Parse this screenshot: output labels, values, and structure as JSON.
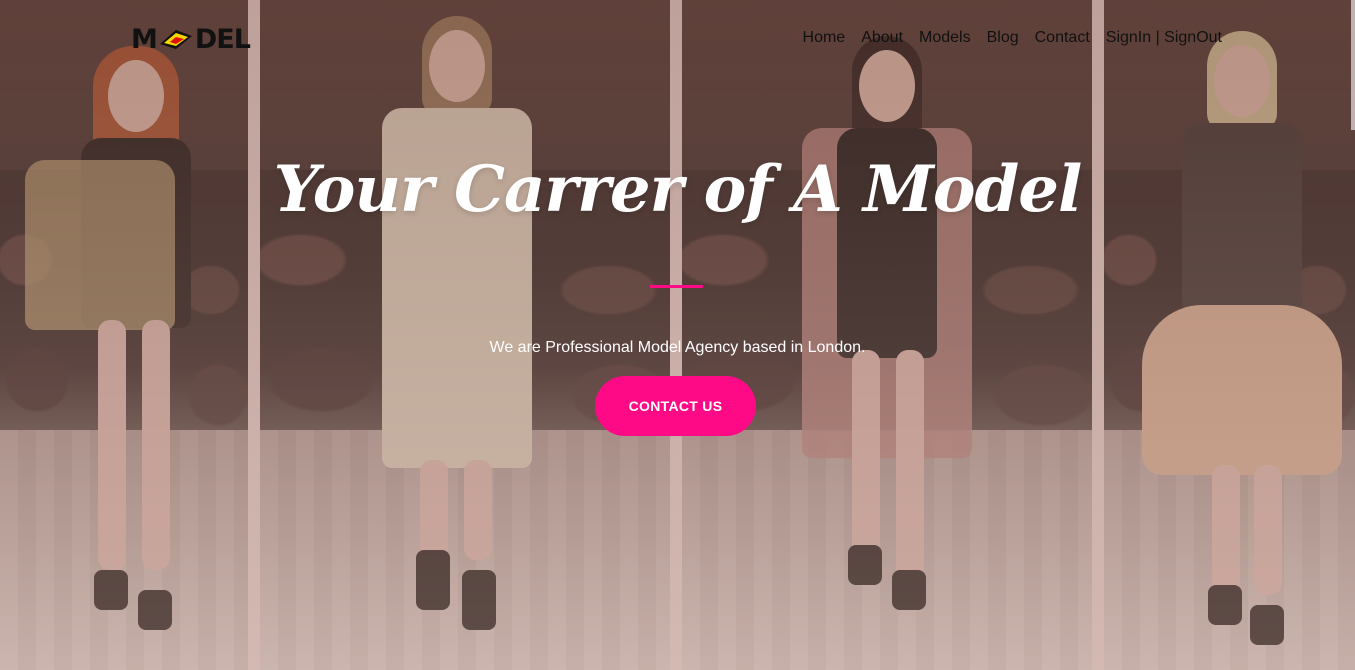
{
  "brand": {
    "logo_text_left": "M",
    "logo_text_right": "DEL",
    "logo_colors": [
      "#111111",
      "#f7d500",
      "#e01010"
    ]
  },
  "nav": {
    "items": [
      {
        "label": "Home"
      },
      {
        "label": "About"
      },
      {
        "label": "Models"
      },
      {
        "label": "Blog"
      },
      {
        "label": "Contact"
      },
      {
        "label": "SignIn | SignOut"
      }
    ]
  },
  "hero": {
    "title": "Your Carrer of A Model",
    "tagline": "We are Professional Model Agency based in London.",
    "cta_label": "CONTACT US",
    "accent_color": "#ff0a86"
  }
}
